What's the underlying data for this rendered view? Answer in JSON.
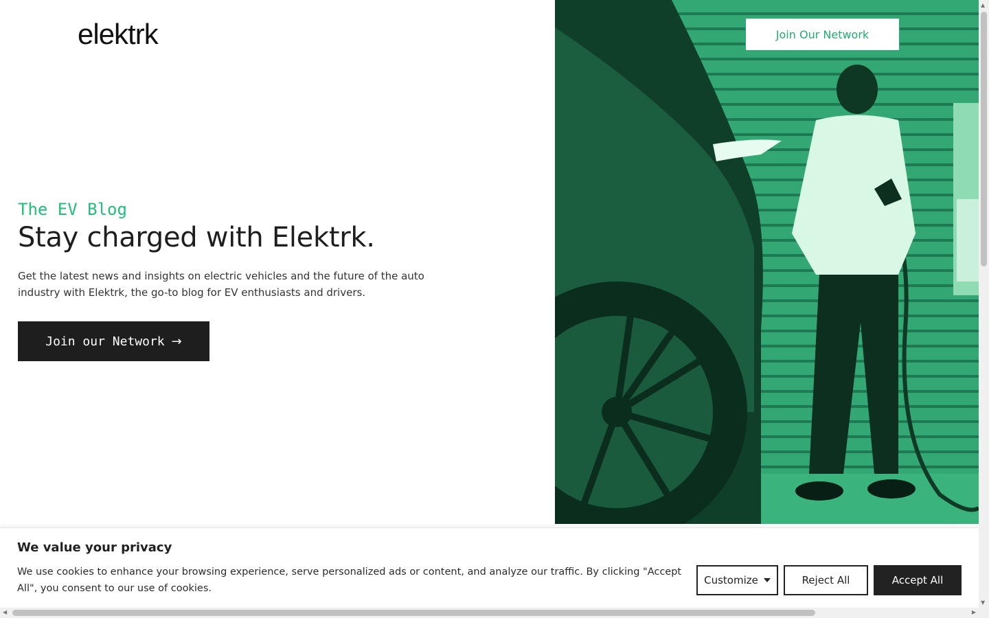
{
  "header": {
    "logo": "elektrk",
    "join_button": "Join Our Network"
  },
  "hero": {
    "eyebrow": "The EV Blog",
    "headline": "Stay charged with Elektrk.",
    "lead": "Get the latest news and insights on electric vehicles and the future of the auto industry with Elektrk, the go-to blog for EV enthusiasts and drivers.",
    "cta_label": "Join our Network",
    "cta_arrow": "→"
  },
  "cookie_banner": {
    "title": "We value your privacy",
    "text": "We use cookies to enhance your browsing experience, serve personalized ads or content, and analyze our traffic. By clicking \"Accept All\", you consent to our use of cookies.",
    "customize_label": "Customize",
    "reject_label": "Reject All",
    "accept_label": "Accept All"
  },
  "colors": {
    "accent": "#20c07a",
    "dark": "#1e1e1e",
    "image_tint": "#2a9a68"
  },
  "icons": {
    "cta_arrow": "arrow-right-icon",
    "customize_caret": "caret-down-icon"
  }
}
